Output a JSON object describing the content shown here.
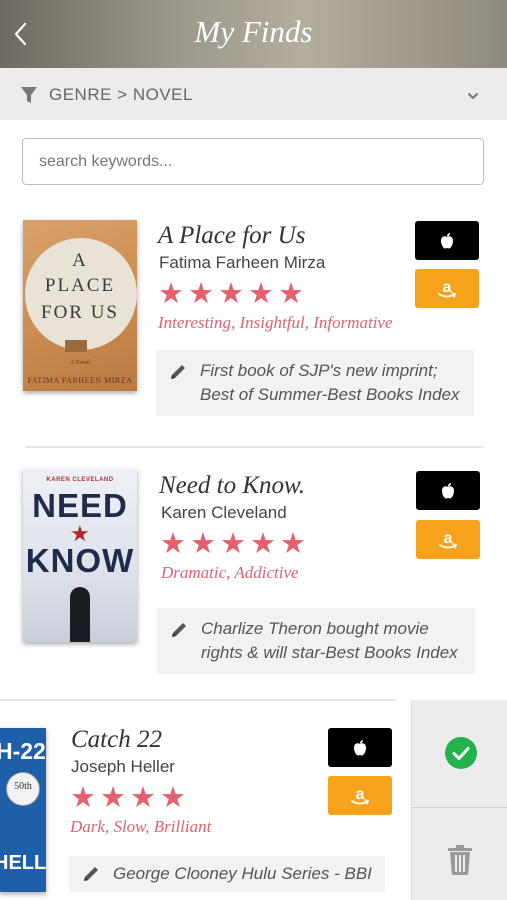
{
  "header": {
    "title": "My Finds"
  },
  "filter": {
    "label": "GENRE > NOVEL"
  },
  "search": {
    "placeholder": "search keywords..."
  },
  "books": [
    {
      "title": "A Place for Us",
      "author": "Fatima Farheen Mirza",
      "rating": 5,
      "tags": "Interesting, Insightful, Informative",
      "note_line1": "First book of SJP's new imprint;",
      "note_line2": "Best of Summer-Best Books Index",
      "cover": {
        "line1": "A",
        "line2": "PLACE",
        "line3": "FOR US",
        "author": "FATIMA FARHEEN MIRZA",
        "small": "A Novel"
      }
    },
    {
      "title": "Need to Know.",
      "author": "Karen Cleveland",
      "rating": 5,
      "tags": "Dramatic, Addictive",
      "note_line1": "Charlize Theron bought movie",
      "note_line2": "rights & will star-Best Books Index",
      "cover": {
        "top": "KAREN CLEVELAND",
        "line1": "NEED",
        "line2": "KNOW"
      }
    },
    {
      "title": "Catch 22",
      "author": "Joseph Heller",
      "rating": 4,
      "tags": "Dark, Slow, Brilliant",
      "note_line1": "George Clooney Hulu Series - BBI",
      "cover": {
        "top": "H-22",
        "badge": "50th",
        "bottom": "HELLER"
      }
    }
  ],
  "colors": {
    "accent": "#e4606d",
    "amazon": "#f7a21b",
    "apple": "#000000",
    "check": "#22b24c"
  }
}
